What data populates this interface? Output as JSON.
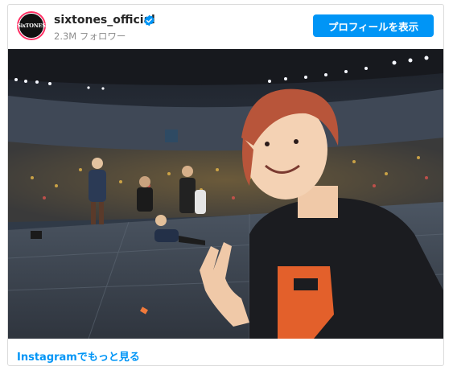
{
  "post": {
    "username": "sixtones_official",
    "avatar_text": "SixTONES",
    "followers": "2.3M フォロワー",
    "profile_button": "プロフィールを表示",
    "more_link": "Instagramでもっと見る"
  },
  "icons": {
    "verified": "verified-badge-icon"
  },
  "colors": {
    "accent": "#0095f6",
    "avatar_ring": "#ff2e63",
    "username": "#262626",
    "muted": "#8e8e8e"
  },
  "photo": {
    "description_visible": "concert selfie on stage in a stadium"
  }
}
